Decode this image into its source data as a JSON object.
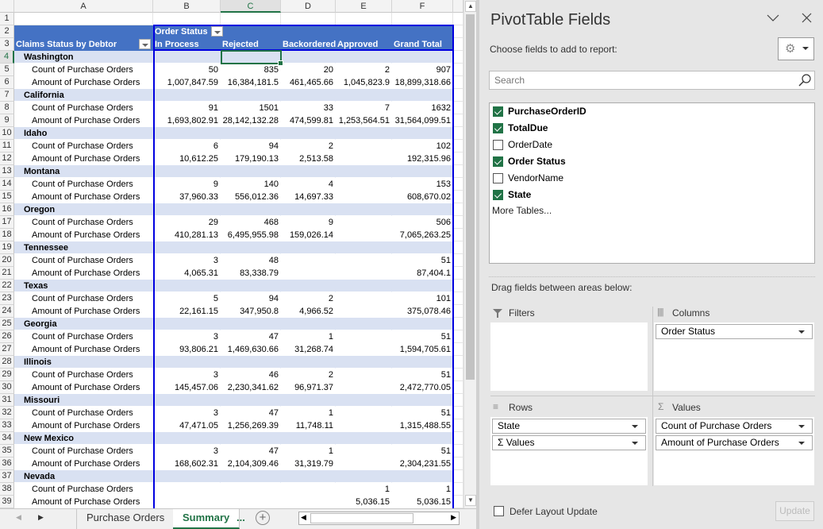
{
  "columns": [
    "A",
    "B",
    "C",
    "D",
    "E",
    "F"
  ],
  "pivot": {
    "column_field": "Order Status",
    "row_field": "Claims Status by Debtor",
    "headers": [
      "In Process",
      "Rejected",
      "Backordered",
      "Approved",
      "Grand Total"
    ],
    "count_label": "Count of Purchase Orders",
    "amount_label": "Amount of Purchase Orders",
    "states": [
      {
        "name": "Washington",
        "count": [
          "50",
          "835",
          "20",
          "2",
          "907"
        ],
        "amount": [
          "1,007,847.59",
          "16,384,181.5",
          "461,465.66",
          "1,045,823.9",
          "18,899,318.66"
        ]
      },
      {
        "name": "California",
        "count": [
          "91",
          "1501",
          "33",
          "7",
          "1632"
        ],
        "amount": [
          "1,693,802.91",
          "28,142,132.28",
          "474,599.81",
          "1,253,564.51",
          "31,564,099.51"
        ]
      },
      {
        "name": "Idaho",
        "count": [
          "6",
          "94",
          "2",
          "",
          "102"
        ],
        "amount": [
          "10,612.25",
          "179,190.13",
          "2,513.58",
          "",
          "192,315.96"
        ]
      },
      {
        "name": "Montana",
        "count": [
          "9",
          "140",
          "4",
          "",
          "153"
        ],
        "amount": [
          "37,960.33",
          "556,012.36",
          "14,697.33",
          "",
          "608,670.02"
        ]
      },
      {
        "name": "Oregon",
        "count": [
          "29",
          "468",
          "9",
          "",
          "506"
        ],
        "amount": [
          "410,281.13",
          "6,495,955.98",
          "159,026.14",
          "",
          "7,065,263.25"
        ]
      },
      {
        "name": "Tennessee",
        "count": [
          "3",
          "48",
          "",
          "",
          "51"
        ],
        "amount": [
          "4,065.31",
          "83,338.79",
          "",
          "",
          "87,404.1"
        ]
      },
      {
        "name": "Texas",
        "count": [
          "5",
          "94",
          "2",
          "",
          "101"
        ],
        "amount": [
          "22,161.15",
          "347,950.8",
          "4,966.52",
          "",
          "375,078.46"
        ]
      },
      {
        "name": "Georgia",
        "count": [
          "3",
          "47",
          "1",
          "",
          "51"
        ],
        "amount": [
          "93,806.21",
          "1,469,630.66",
          "31,268.74",
          "",
          "1,594,705.61"
        ]
      },
      {
        "name": "Illinois",
        "count": [
          "3",
          "46",
          "2",
          "",
          "51"
        ],
        "amount": [
          "145,457.06",
          "2,230,341.62",
          "96,971.37",
          "",
          "2,472,770.05"
        ]
      },
      {
        "name": "Missouri",
        "count": [
          "3",
          "47",
          "1",
          "",
          "51"
        ],
        "amount": [
          "47,471.05",
          "1,256,269.39",
          "11,748.11",
          "",
          "1,315,488.55"
        ]
      },
      {
        "name": "New Mexico",
        "count": [
          "3",
          "47",
          "1",
          "",
          "51"
        ],
        "amount": [
          "168,602.31",
          "2,104,309.46",
          "31,319.79",
          "",
          "2,304,231.55"
        ]
      },
      {
        "name": "Nevada",
        "count": [
          "",
          "",
          "",
          "1",
          "1"
        ],
        "amount": [
          "",
          "",
          "",
          "5,036.15",
          "5,036.15"
        ]
      }
    ]
  },
  "tabs": {
    "sheet1": "Purchase Orders",
    "sheet2": "Summary",
    "more": "..."
  },
  "panel": {
    "title": "PivotTable Fields",
    "choose_label": "Choose fields to add to report:",
    "search_placeholder": "Search",
    "fields": [
      {
        "name": "PurchaseOrderID",
        "checked": true
      },
      {
        "name": "TotalDue",
        "checked": true
      },
      {
        "name": "OrderDate",
        "checked": false
      },
      {
        "name": "Order Status",
        "checked": true
      },
      {
        "name": "VendorName",
        "checked": false
      },
      {
        "name": "State",
        "checked": true
      }
    ],
    "more_tables": "More Tables...",
    "drag_label": "Drag fields between areas below:",
    "filters_label": "Filters",
    "columns_label": "Columns",
    "rows_label": "Rows",
    "values_label": "Values",
    "columns_items": [
      "Order Status"
    ],
    "rows_items": [
      "State",
      "Σ  Values"
    ],
    "values_items": [
      "Count of Purchase Orders",
      "Amount of Purchase Orders"
    ],
    "defer_label": "Defer Layout Update",
    "defer_checked": false,
    "update_label": "Update"
  },
  "colors": {
    "pivot_header": "#4472C4",
    "pivot_band": "#D9E1F2",
    "pivot_border": "#0000E0",
    "accent": "#217346"
  }
}
